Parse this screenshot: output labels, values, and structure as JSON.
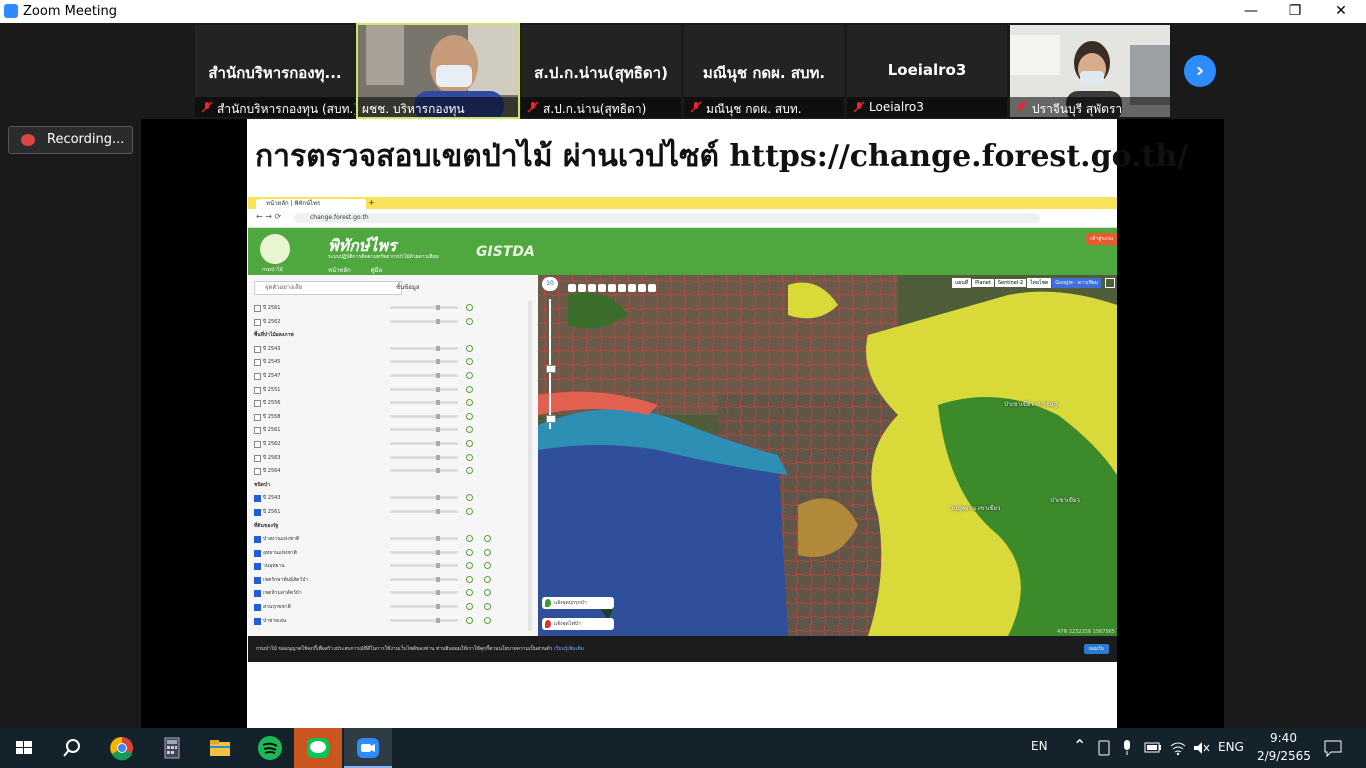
{
  "window": {
    "title": "Zoom Meeting",
    "minimize_symbol": "—",
    "restore_symbol": "❐",
    "close_symbol": "✕"
  },
  "participants": [
    {
      "big_name": "สำนักบริหารกองทุ...",
      "name": "สำนักบริหารกองทุน (สบท.)",
      "video": false
    },
    {
      "big_name": "",
      "name": "ผชช. บริหารกองทุน",
      "video": true,
      "active": true
    },
    {
      "big_name": "ส.ป.ก.น่าน(สุทธิดา)",
      "name": "ส.ป.ก.น่าน(สุทธิดา)",
      "video": false
    },
    {
      "big_name": "มณีนุช กดผ. สบท.",
      "name": "มณีนุช กดผ. สบท.",
      "video": false
    },
    {
      "big_name": "Loeialro3",
      "name": "Loeialro3",
      "video": false
    },
    {
      "big_name": "",
      "name": "ปราจีนบุรี สุพัตรา",
      "video": true
    }
  ],
  "gallery": {
    "next_symbol": "›"
  },
  "recording": {
    "label": "Recording..."
  },
  "slide": {
    "title": "การตรวจสอบเขตป่าไม้ ผ่านเวปไซต์ https://change.forest.go.th/"
  },
  "browser": {
    "tab_label": "หน้าหลัก | พิทักษ์ไพร",
    "new_tab": "+",
    "url": "change.forest.go.th"
  },
  "site": {
    "title": "พิทักษ์ไพร",
    "subtitle": "ระบบปฏิบัติการติดตามทรัพยากรป่าไม้ด้วยดาวเทียม",
    "dept": "กรมป่าไม้",
    "gistda": "GISTDA",
    "nav": [
      "หน้าหลัก",
      "คู่มือ"
    ],
    "login": "เข้าสู่ระบบ"
  },
  "panel": {
    "search_placeholder": "จุดตัวอย่างเสีย",
    "tool_label": "ชั้นข้อมูล",
    "rows": [
      {
        "type": "item",
        "label": "ปี 2561",
        "checked": false
      },
      {
        "type": "item",
        "label": "ปี 2562",
        "checked": false
      },
      {
        "type": "head",
        "label": "พื้นที่ป่าไม้ผลงภาพ"
      },
      {
        "type": "item",
        "label": "ปี 2543",
        "checked": false
      },
      {
        "type": "item",
        "label": "ปี 2545",
        "checked": false
      },
      {
        "type": "item",
        "label": "ปี 2547",
        "checked": false
      },
      {
        "type": "item",
        "label": "ปี 2551",
        "checked": false
      },
      {
        "type": "item",
        "label": "ปี 2556",
        "checked": false
      },
      {
        "type": "item",
        "label": "ปี 2558",
        "checked": false
      },
      {
        "type": "item",
        "label": "ปี 2561",
        "checked": false
      },
      {
        "type": "item",
        "label": "ปี 2562",
        "checked": false
      },
      {
        "type": "item",
        "label": "ปี 2563",
        "checked": false
      },
      {
        "type": "item",
        "label": "ปี 2564",
        "checked": false
      },
      {
        "type": "head",
        "label": "ชนิดป่า"
      },
      {
        "type": "item",
        "label": "ปี 2543",
        "checked": true
      },
      {
        "type": "item",
        "label": "ปี 2561",
        "checked": true
      },
      {
        "type": "head",
        "label": "ที่ดินของรัฐ"
      },
      {
        "type": "item2",
        "label": "ป่าสงวนแห่งชาติ",
        "checked": true
      },
      {
        "type": "item2",
        "label": "อุทยานแห่งชาติ",
        "checked": true
      },
      {
        "type": "item2",
        "label": "วนอุทยาน",
        "checked": true
      },
      {
        "type": "item2",
        "label": "เขตรักษาพันธุ์สัตว์ป่า",
        "checked": true
      },
      {
        "type": "item2",
        "label": "เขตห้ามล่าสัตว์ป่า",
        "checked": true
      },
      {
        "type": "item2",
        "label": "สวนรุกขชาติ",
        "checked": true
      },
      {
        "type": "item2",
        "label": "ป่าชายเลน",
        "checked": true
      }
    ]
  },
  "map": {
    "zoom_level": "10",
    "layers": [
      "แผนที่",
      "Planet",
      "Sentinel-2",
      "ไทยโชต",
      "Google - ดาวเทียม"
    ],
    "selected_layer": "Google - ดาวเทียม",
    "buttons": [
      "แจ้งจุดบุกรุกป่า",
      "แจ้งจุดไฟป่า"
    ],
    "labels": [
      "ป่าเขาเขียว-เขาชมภู่",
      "ป่าเขาเขียว",
      "วนอุทยาน เขาเขียว"
    ],
    "coords": "47N 2232156 1567565"
  },
  "cookie": {
    "text": "กรมป่าไม้ ขออนุญาตใช้คุกกี้เพื่อสร้างประสบการณ์ที่ดีในการใช้งานเว็บไซต์ของท่าน ท่านยินยอมให้เราใช้คุกกี้ตามนโยบายความเป็นส่วนตัว",
    "link": "เรียนรู้เพิ่มเติม",
    "accept": "ยอมรับ"
  },
  "taskbar": {
    "language": "EN",
    "keyboard": "ENG",
    "time": "9:40",
    "date": "2/9/2565"
  },
  "colors": {
    "zoom_blue": "#2d8cff",
    "site_green": "#4fa83d",
    "slide_bg": "#ffffff",
    "map_forest_yellow": "#d9d93a",
    "taskbar": "#14222b"
  }
}
